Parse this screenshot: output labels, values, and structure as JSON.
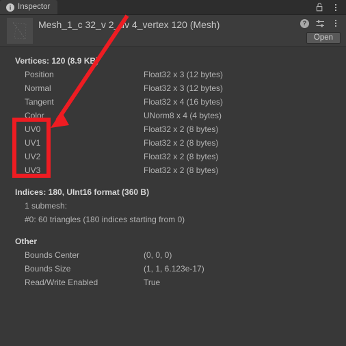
{
  "window": {
    "tab": {
      "label": "Inspector",
      "icon": "info-icon"
    },
    "tab_right_icons": [
      "lock-icon",
      "more-menu-icon"
    ]
  },
  "header": {
    "asset_title": "Mesh_1_c 32_v 2_uv 4_vertex 120 (Mesh)",
    "thumbnail_icon": "mesh-preview-thumbnail",
    "help_label": "?",
    "icons": [
      "help-icon",
      "preset-settings-icon",
      "more-menu-icon"
    ],
    "open_button": "Open"
  },
  "vertices": {
    "title": "Vertices: 120 (8.9 KB)",
    "attributes": [
      {
        "name": "Position",
        "format": "Float32 x 3 (12 bytes)"
      },
      {
        "name": "Normal",
        "format": "Float32 x 3 (12 bytes)"
      },
      {
        "name": "Tangent",
        "format": "Float32 x 4 (16 bytes)"
      },
      {
        "name": "Color",
        "format": "UNorm8 x 4 (4 bytes)"
      },
      {
        "name": "UV0",
        "format": "Float32 x 2 (8 bytes)"
      },
      {
        "name": "UV1",
        "format": "Float32 x 2 (8 bytes)"
      },
      {
        "name": "UV2",
        "format": "Float32 x 2 (8 bytes)"
      },
      {
        "name": "UV3",
        "format": "Float32 x 2 (8 bytes)"
      }
    ]
  },
  "indices": {
    "title": "Indices: 180, UInt16 format (360 B)",
    "submesh_count_label": "1 submesh:",
    "submeshes": [
      "#0: 60 triangles (180 indices starting from 0)"
    ]
  },
  "other": {
    "title": "Other",
    "properties": [
      {
        "name": "Bounds Center",
        "value": "(0, 0, 0)"
      },
      {
        "name": "Bounds Size",
        "value": "(1, 1, 6.123e-17)"
      },
      {
        "name": "Read/Write Enabled",
        "value": "True"
      }
    ]
  },
  "annotations": {
    "highlight_color": "#ee1c22",
    "box_label": "uv-channels-highlight",
    "arrow_label": "uv-channels-arrow"
  }
}
